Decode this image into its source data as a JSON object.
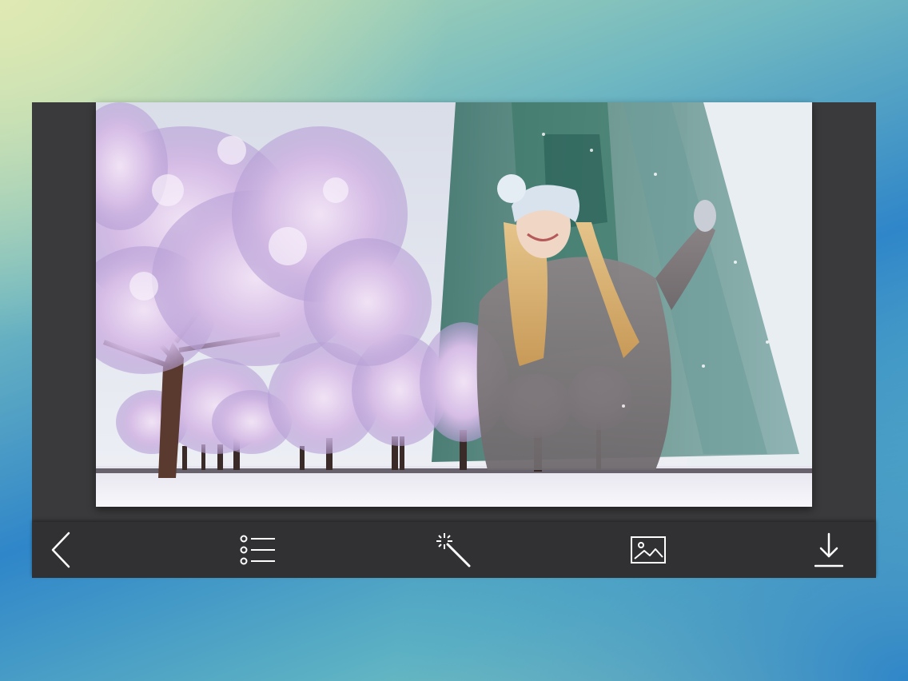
{
  "app": {
    "accent_color": "#ffffff",
    "frame_color": "#3a3a3c",
    "toolbar_color": "#313133"
  },
  "toolbar": {
    "items": [
      {
        "id": "back",
        "icon": "chevron-left-icon"
      },
      {
        "id": "frames",
        "icon": "list-icon"
      },
      {
        "id": "effects",
        "icon": "magic-wand-icon"
      },
      {
        "id": "gallery",
        "icon": "image-icon"
      },
      {
        "id": "save",
        "icon": "download-icon"
      }
    ]
  },
  "canvas": {
    "photo": "winter-trees-woman-eiffel-tower-collage"
  }
}
